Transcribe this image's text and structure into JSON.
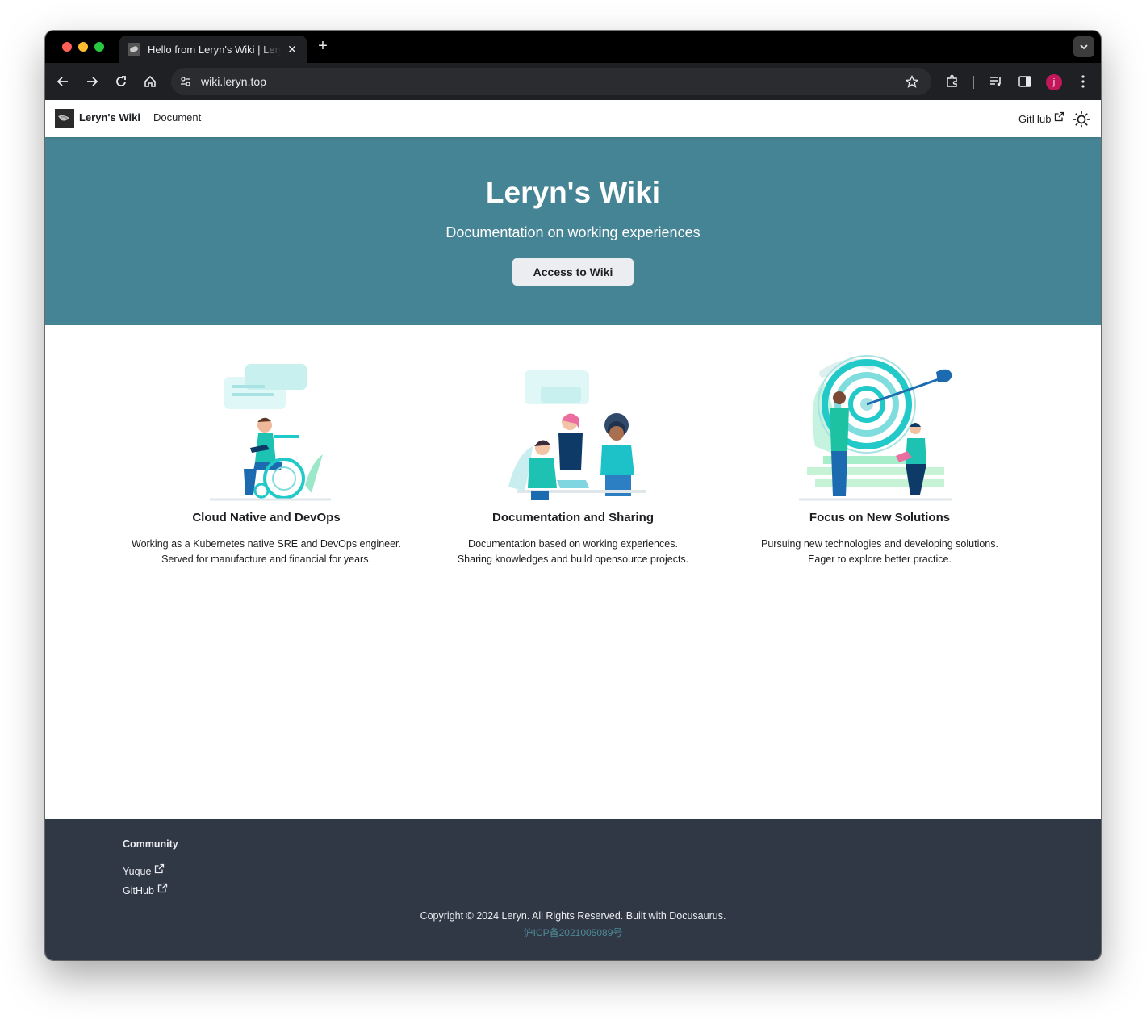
{
  "browser": {
    "tab_title": "Hello from Leryn's Wiki | Leryn's Wiki",
    "url": "wiki.leryn.top",
    "profile_initial": "j",
    "icons": [
      "back-icon",
      "forward-icon",
      "reload-icon",
      "home-icon",
      "site-info-icon",
      "bookmark-star-icon",
      "extensions-icon",
      "media-icon",
      "side-panel-icon",
      "more-icon"
    ]
  },
  "navbar": {
    "brand": "Leryn's Wiki",
    "document": "Document",
    "github": "GitHub"
  },
  "hero": {
    "title": "Leryn's Wiki",
    "subtitle": "Documentation on working experiences",
    "button": "Access to Wiki"
  },
  "features": [
    {
      "title": "Cloud Native and DevOps",
      "line1": "Working as a Kubernetes native SRE and DevOps engineer.",
      "line2": "Served for manufacture and financial for years."
    },
    {
      "title": "Documentation and Sharing",
      "line1": "Documentation based on working experiences.",
      "line2": "Sharing knowledges and build opensource projects."
    },
    {
      "title": "Focus on New Solutions",
      "line1": "Pursuing new technologies and developing solutions.",
      "line2": "Eager to explore better practice."
    }
  ],
  "footer": {
    "community_title": "Community",
    "links": [
      "Yuque",
      "GitHub"
    ],
    "copyright": "Copyright © 2024 Leryn. All Rights Reserved. Built with Docusaurus.",
    "icp": "沪ICP备2021005089号"
  },
  "colors": {
    "hero_bg": "#458494",
    "footer_bg": "#303846",
    "accent": "#22c9c9"
  }
}
